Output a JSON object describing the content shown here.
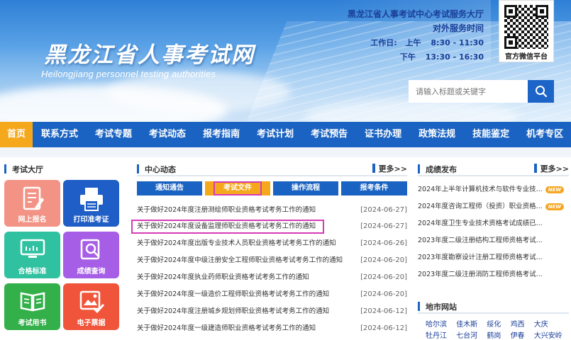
{
  "header": {
    "site_title": "黑龙江省人事考试网",
    "site_subtitle": "Heilongjiang personnel testing authorities",
    "service_org": "黑龙江省人事考试中心考试服务大厅",
    "service_hours_label": "对外服务时间",
    "workday_label": "工作日:",
    "morning_label": "上午",
    "morning_time": "8:30 - 11:30",
    "afternoon_label": "下午",
    "afternoon_time": "13:30 - 16:30",
    "wechat_label": "官方微信平台",
    "search_placeholder": "请输入标题或关键字"
  },
  "nav": {
    "items": [
      "首页",
      "联系方式",
      "考试专题",
      "考试动态",
      "报考指南",
      "考试计划",
      "考试预告",
      "证书办理",
      "政策法规",
      "技能鉴定",
      "机考专区"
    ],
    "active_index": 0
  },
  "hall": {
    "title": "考试大厅",
    "tiles": [
      {
        "label": "网上报名",
        "color": "#f39385"
      },
      {
        "label": "打印准考证",
        "color": "#1f5ec6"
      },
      {
        "label": "合格标准",
        "color": "#2fc1a0"
      },
      {
        "label": "成绩查询",
        "color": "#a65ee6"
      },
      {
        "label": "考试用书",
        "color": "#33b04a"
      },
      {
        "label": "电子票据",
        "color": "#f0553b"
      }
    ]
  },
  "center": {
    "title": "中心动态",
    "more": "更多>>",
    "tabs": [
      "通知通告",
      "考试文件",
      "操作流程",
      "报考条件"
    ],
    "active_tab": 1,
    "news": [
      {
        "title": "关于做好2024年度注册测绘师职业资格考试考务工作的通知",
        "date": "[2024-06-27]"
      },
      {
        "title": "关于做好2024年度设备监理师职业资格考试考务工作的通知",
        "date": "[2024-06-27]"
      },
      {
        "title": "关于做好2024年度出版专业技术人员职业资格考试考务工作的通知",
        "date": "[2024-06-26]"
      },
      {
        "title": "关于做好2024年度中级注册安全工程师职业资格考试考务工作的通知",
        "date": "[2024-06-20]"
      },
      {
        "title": "关于做好2024年度执业药师职业资格考试考务工作的通知",
        "date": "[2024-06-20]"
      },
      {
        "title": "关于做好2024年度一级造价工程师职业资格考试考务工作的通知",
        "date": "[2024-06-20]"
      },
      {
        "title": "关于做好2024年度注册城乡规划师职业资格考试考务工作的通知",
        "date": "[2024-06-12]"
      },
      {
        "title": "关于做好2024年度一级建造师职业资格考试考务工作的通知",
        "date": "[2024-06-12]"
      }
    ]
  },
  "results": {
    "title": "成绩发布",
    "more": "更多>>",
    "new_badge": "NEW",
    "items": [
      {
        "title": "2024年上半年计算机技术与软件专业技...",
        "is_new": true
      },
      {
        "title": "2024年度咨询工程师（投资）职业资格...",
        "is_new": true
      },
      {
        "title": "2024年度卫生专业技术资格考试成绩已...",
        "is_new": false
      },
      {
        "title": "2023年度二级注册结构工程师资格考试...",
        "is_new": false
      },
      {
        "title": "2023年度勘察设计注册工程师资格考试...",
        "is_new": false
      },
      {
        "title": "2023年度二级注册消防工程师资格考试...",
        "is_new": false
      }
    ]
  },
  "cities": {
    "title": "地市网站",
    "row1": [
      "哈尔滨",
      "佳木斯",
      "绥化",
      "鸡西",
      "大庆"
    ],
    "row2": [
      "牡丹江",
      "七台河",
      "鹤岗",
      "伊春",
      "大兴安岭"
    ]
  },
  "colors": {
    "nav_bg": "#1b63c2",
    "accent": "#f6a81c",
    "highlight_frame": "#d63bb5"
  }
}
